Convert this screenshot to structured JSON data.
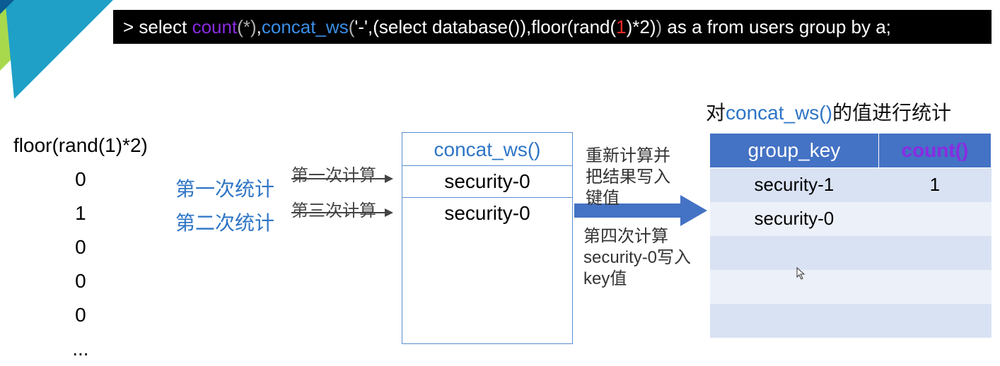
{
  "sql": {
    "prompt": "> ",
    "select": "select",
    "count": "count",
    "count_arg": "(*)",
    "comma1": ",",
    "concat_ws": "concat_ws",
    "open1": "(",
    "dash": "'-'",
    "comma2": ",(",
    "select2": "select",
    "dbfn": "database()",
    "close1": "),",
    "floor": "floor(rand(",
    "one": "1",
    "tail": ")*2)",
    "close2": ")",
    "rest": " as a from users group by a;"
  },
  "floor_header": "floor(rand(1)*2)",
  "floor_values": [
    "0",
    "1",
    "0",
    "0",
    "0",
    "..."
  ],
  "stats": {
    "line1": "第一次统计",
    "line2": "第二次统计"
  },
  "calc": {
    "c1": "第一次计算",
    "c3": "第三次计算"
  },
  "concat": {
    "header": "concat_ws()",
    "rows": [
      "security-0",
      "security-0"
    ]
  },
  "annot1": "重新计算并把结果写入键值",
  "annot2": "第四次计算security-0写入key值",
  "toptitle": {
    "prefix": "对",
    "fn": "concat_ws()",
    "suffix": "的值进行统计"
  },
  "grptable": {
    "headers": {
      "key": "group_key",
      "count": "count()"
    },
    "rows": [
      {
        "k": "security-1",
        "c": "1"
      },
      {
        "k": "security-0",
        "c": ""
      },
      {
        "k": "",
        "c": ""
      },
      {
        "k": "",
        "c": ""
      },
      {
        "k": "",
        "c": ""
      }
    ]
  }
}
